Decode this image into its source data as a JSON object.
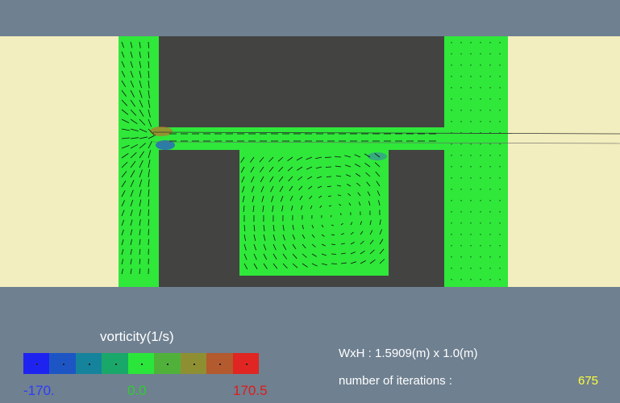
{
  "colors": {
    "background": "#6f8090",
    "inflow_region": "#f3eebf",
    "fluid": "#2fe83a",
    "solid": "#434442",
    "arrow": "#111111",
    "min_text": "#2b3bff",
    "mid_text": "#2bd12b",
    "max_text": "#e01a1a",
    "iter_value_text": "#ffff3a"
  },
  "legend": {
    "title": "vorticity(1/s)",
    "min_label": "-170.",
    "mid_label": "0.0",
    "max_label": "170.5",
    "swatches": [
      "#1f23f0",
      "#1d56c4",
      "#15839b",
      "#1aa86a",
      "#2be63a",
      "#50b13a",
      "#8e8f32",
      "#b35a2e",
      "#e02522"
    ]
  },
  "info": {
    "dimensions": "WxH : 1.5909(m) x 1.0(m)",
    "iterations_label": "number of iterations :",
    "iterations_value": "675"
  }
}
